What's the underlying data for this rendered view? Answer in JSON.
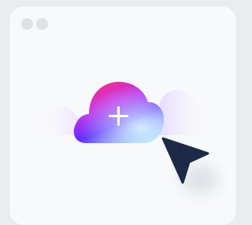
{
  "window": {
    "control_dots": [
      "dot-1",
      "dot-2"
    ]
  },
  "upload": {
    "icon": "cloud-upload-icon",
    "symbol": "+"
  },
  "pointer": {
    "icon": "cursor-arrow-icon"
  },
  "colors": {
    "page_background": "#e9edf0",
    "window_background": "#f8f9fa",
    "control_dot": "#dde2e6",
    "cloud_gradient": [
      "#ff2d7a",
      "#a733ff",
      "#4f30ff",
      "#bfe8ff"
    ],
    "side_cloud": "#e7e0ff",
    "cursor": "#1c2a47"
  }
}
